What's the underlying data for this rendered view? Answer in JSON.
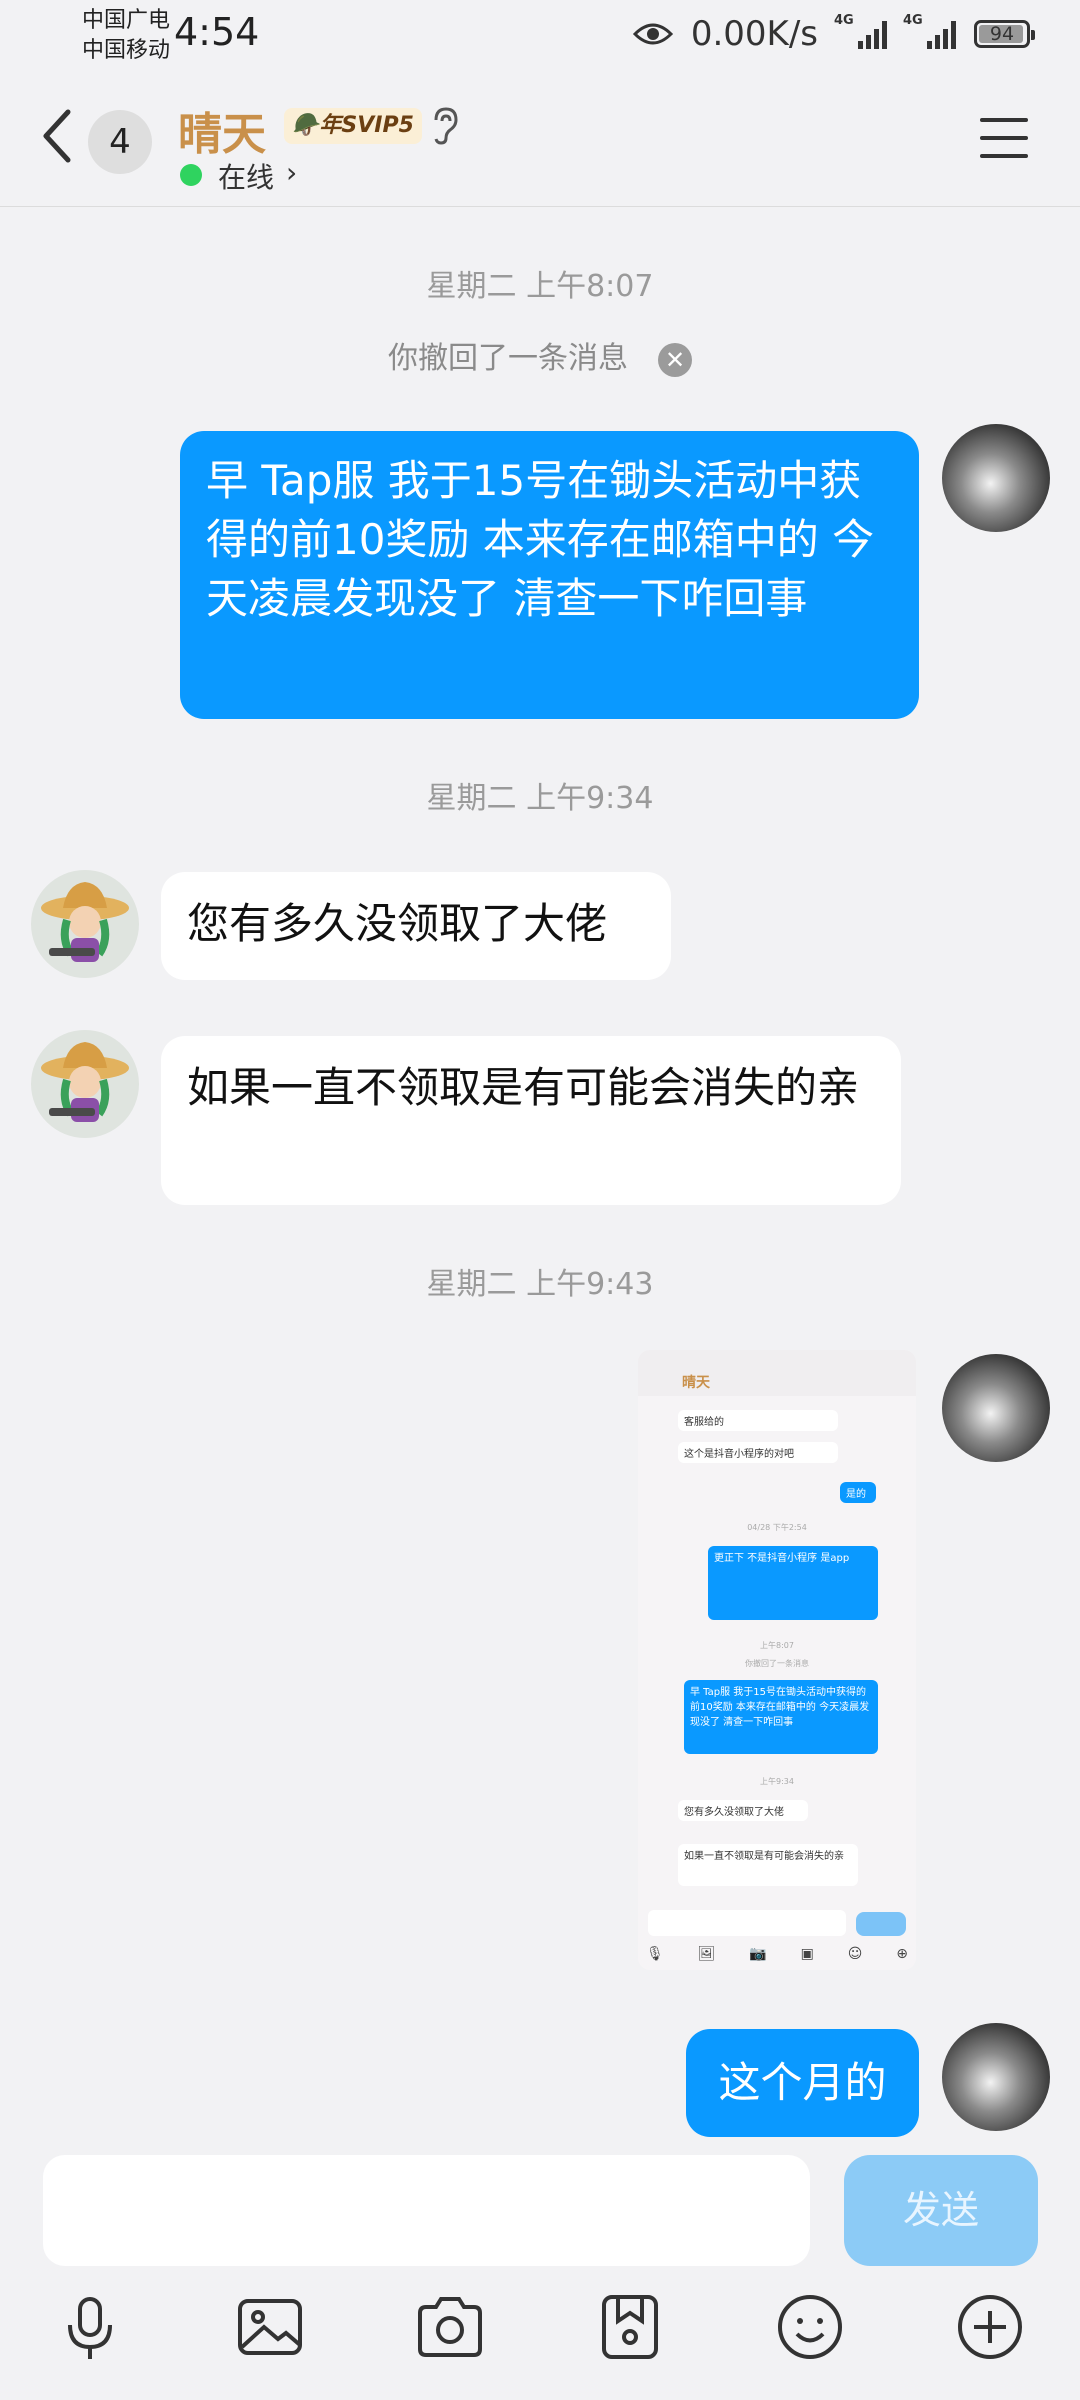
{
  "status_bar": {
    "carrier1": "中国广电",
    "carrier2": "中国移动",
    "time": "4:54",
    "net_speed": "0.00K/s",
    "signal1_label": "4G",
    "signal2_label": "4G",
    "battery": "94"
  },
  "header": {
    "unread_count": "4",
    "contact_name": "晴天",
    "vip_badge": "年SVIP5",
    "status": "在线"
  },
  "messages": [
    {
      "type": "timestamp",
      "text": "星期二 上午8:07"
    },
    {
      "type": "recall",
      "text": "你撤回了一条消息"
    },
    {
      "type": "outgoing",
      "text": "早  Tap服 我于15号在锄头活动中获得的前10奖励 本来存在邮箱中的 今天凌晨发现没了 清查一下咋回事"
    },
    {
      "type": "timestamp",
      "text": "星期二 上午9:34"
    },
    {
      "type": "incoming",
      "text": "您有多久没领取了大佬"
    },
    {
      "type": "incoming",
      "text": "如果一直不领取是有可能会消失的亲"
    },
    {
      "type": "timestamp",
      "text": "星期二 上午9:43"
    },
    {
      "type": "outgoing-image",
      "text": "screenshot"
    },
    {
      "type": "outgoing",
      "text": "这个月的"
    }
  ],
  "screenshot": {
    "title": "晴天",
    "msg1": "客服给的",
    "msg2": "这个是抖音小程序的对吧",
    "msg3": "是的",
    "ts1": "04/28 下午2:54",
    "msg4": "更正下 不是抖音小程序 是app",
    "ts2": "上午8:07",
    "recall": "你撤回了一条消息",
    "msg5": "早  Tap服 我于15号在锄头活动中获得的前10奖励 本来存在邮箱中的 今天凌晨发现没了 清查一下咋回事",
    "ts3": "上午9:34",
    "msg6": "您有多久没领取了大佬",
    "msg7": "如果一直不领取是有可能会消失的亲",
    "send": "发送"
  },
  "input": {
    "placeholder": "",
    "send_label": "发送"
  },
  "toolbar": [
    "mic-icon",
    "image-icon",
    "camera-icon",
    "favorite-icon",
    "emoji-icon",
    "plus-icon"
  ],
  "colors": {
    "accent": "#0a99ff",
    "name": "#c9904a",
    "online": "#2fd35f",
    "send_disabled": "#8ccbf6"
  }
}
